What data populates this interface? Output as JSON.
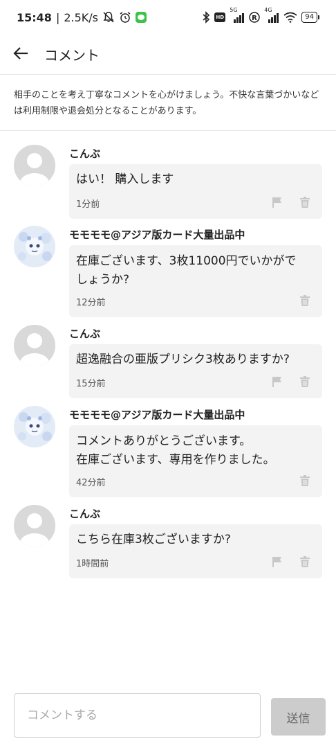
{
  "status_bar": {
    "time": "15:48",
    "network_speed": "2.5K/s",
    "icons": [
      "notification-off-icon",
      "alarm-icon",
      "line-app-icon",
      "bluetooth-icon",
      "hd-icon",
      "signal-5g-icon",
      "registered-icon",
      "signal-4g-icon",
      "wifi-icon"
    ],
    "net_5g": "5G",
    "net_4g": "4G",
    "hd": "HD",
    "battery": "94"
  },
  "header": {
    "back_icon": "arrow-left-icon",
    "title": "コメント"
  },
  "notice": {
    "text": "相手のことを考え丁寧なコメントを心がけましょう。不快な言葉づかいなどは利用制限や退会処分となることがあります。"
  },
  "comments": [
    {
      "user": "こんぶ",
      "avatar": "default-avatar",
      "text_lines": [
        "はい！ 購入します"
      ],
      "time": "1分前",
      "flag": true
    },
    {
      "user": "モモモモ@アジア版カード大量出品中",
      "avatar": "character-avatar",
      "text_lines": [
        "在庫ございます、3枚11000円でいかがで",
        "しょうか?"
      ],
      "time": "12分前",
      "flag": false
    },
    {
      "user": "こんぶ",
      "avatar": "default-avatar",
      "text_lines": [
        "超逸融合の亜版プリシク3枚ありますか?"
      ],
      "time": "15分前",
      "flag": true
    },
    {
      "user": "モモモモ@アジア版カード大量出品中",
      "avatar": "character-avatar",
      "text_lines": [
        "コメントありがとうございます。",
        "在庫ございます、専用を作りました。"
      ],
      "time": "42分前",
      "flag": false
    },
    {
      "user": "こんぶ",
      "avatar": "default-avatar",
      "text_lines": [
        "こちら在庫3枚ございますか?"
      ],
      "time": "1時間前",
      "flag": true
    }
  ],
  "input": {
    "placeholder": "コメントする",
    "value": "",
    "send_label": "送信"
  },
  "colors": {
    "bubble": "#f3f3f3",
    "send_button": "#cccccc",
    "divider": "#e6e6e6"
  }
}
